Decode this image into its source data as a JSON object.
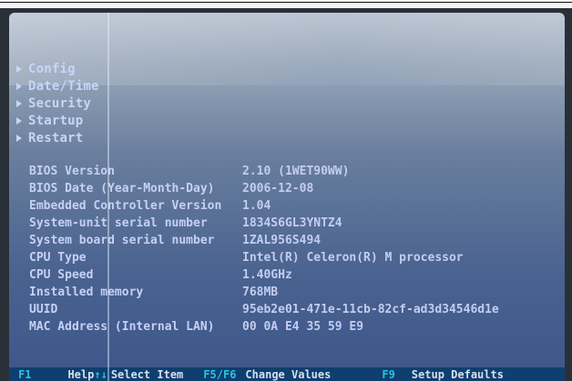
{
  "menu": {
    "items": [
      {
        "label": "Config"
      },
      {
        "label": "Date/Time"
      },
      {
        "label": "Security"
      },
      {
        "label": "Startup"
      },
      {
        "label": "Restart"
      }
    ]
  },
  "info": {
    "rows": [
      {
        "label": "BIOS Version",
        "value": "2.10  (1WET90WW)"
      },
      {
        "label": "BIOS Date (Year-Month-Day)",
        "value": "2006-12-08"
      },
      {
        "label": "Embedded Controller Version",
        "value": "1.04"
      },
      {
        "label": "System-unit serial number",
        "value": "1834S6GL3YNTZ4"
      },
      {
        "label": "System board serial number",
        "value": "1ZAL956S494"
      },
      {
        "label": "CPU Type",
        "value": "Intel(R) Celeron(R) M processor"
      },
      {
        "label": "CPU Speed",
        "value": "1.40GHz"
      },
      {
        "label": "Installed memory",
        "value": "768MB"
      },
      {
        "label": "UUID",
        "value": "95eb2e01-471e-11cb-82cf-ad3d34546d1e"
      },
      {
        "label": "MAC Address (Internal LAN)",
        "value": "00 0A E4 35 59 E9"
      }
    ]
  },
  "footer": {
    "f1_key": "F1",
    "f1_desc": "Help",
    "updown_key": "↑↓",
    "updown_desc": "Select Item",
    "f5f6_key": "F5/F6",
    "f5f6_desc": "Change Values",
    "f9_key": "F9",
    "f9_desc": "Setup Defaults"
  },
  "colors": {
    "screen_bg": "#4a6390",
    "text": "#c6d0f4",
    "footer_bg": "#0e3f6e",
    "footer_key": "#29c2e0"
  }
}
